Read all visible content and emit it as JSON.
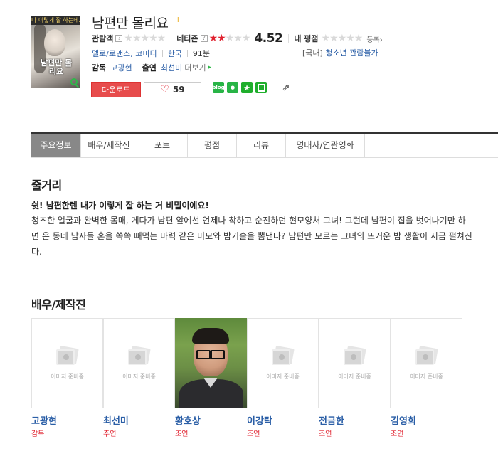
{
  "movie": {
    "title": "남편만 몰리요",
    "title_mark": "l",
    "poster": {
      "top_text": "나 이렇게 잘 하는데...",
      "title_text": "남편만 몰리요"
    },
    "ratings": {
      "audience_label": "관람객",
      "audience_stars": 0,
      "netizen_label": "네티즌",
      "netizen_stars": 2,
      "netizen_score": "4.52",
      "my_label": "내 평점",
      "my_stars": 0,
      "register_label": "등록",
      "qmark": "?"
    },
    "info": {
      "genre": "멜로/로맨스, 코미디",
      "country": "한국",
      "runtime": "91분",
      "grade_tag": "[국내]",
      "grade": "청소년 관람불가"
    },
    "credits": {
      "director_label": "감독",
      "director": "고광현",
      "cast_label": "출연",
      "cast": "최선미",
      "more_label": "더보기",
      "more_arrow": "▸"
    },
    "actions": {
      "download_label": "다운로드",
      "like_count": "59",
      "blog_label": "blog"
    }
  },
  "tabs": [
    "주요정보",
    "배우/제작진",
    "포토",
    "평점",
    "리뷰",
    "명대사/연관영화"
  ],
  "synopsis": {
    "section_title": "줄거리",
    "headline": "쉿! 남편한텐 내가 이렇게 잘 하는 거 비밀이에요!",
    "body": "청초한 얼굴과 완벽한 몸매, 게다가 남편 앞에선 언제나 착하고 순진하던 현모양처 그녀! 그런데 남편이 집을 벗어나기만 하면 온 동네 남자들 혼을 쏙쏙 빼먹는 마력 같은 미모와 밤기술을 뽐낸다? 남편만 모르는 그녀의 뜨거운 밤 생활이 지금 펼쳐진다."
  },
  "cast_section": {
    "section_title": "배우/제작진",
    "no_image_text": "이미지 준비중",
    "members": [
      {
        "name": "고광현",
        "role": "감독",
        "has_photo": false
      },
      {
        "name": "최선미",
        "role": "주연",
        "has_photo": false
      },
      {
        "name": "황호상",
        "role": "조연",
        "has_photo": true
      },
      {
        "name": "이강탁",
        "role": "조연",
        "has_photo": false
      },
      {
        "name": "전금한",
        "role": "조연",
        "has_photo": false
      },
      {
        "name": "김영희",
        "role": "조연",
        "has_photo": false
      }
    ]
  },
  "colors": {
    "accent_red": "#e74c4c",
    "link_blue": "#2a5ea6",
    "share_green": "#28b446",
    "active_tab_bg": "#888888"
  }
}
